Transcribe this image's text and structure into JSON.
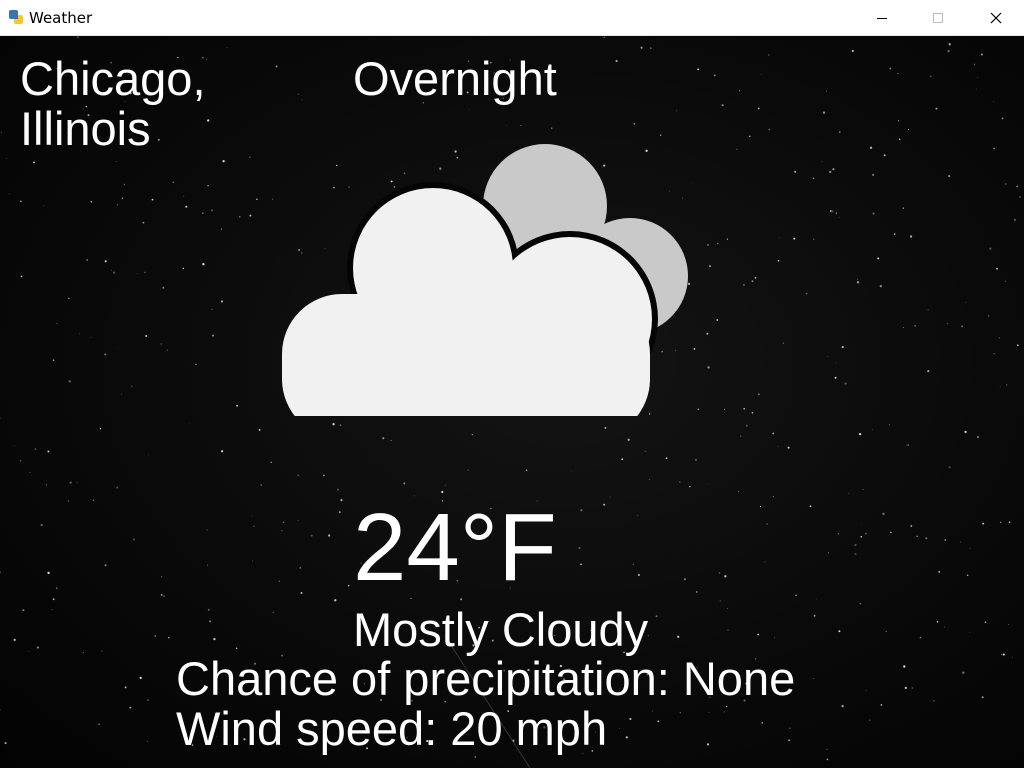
{
  "window": {
    "title": "Weather",
    "icon": "python-app-icon",
    "controls": [
      "minimize",
      "maximize",
      "close"
    ]
  },
  "weather": {
    "city": "Chicago, Illinois",
    "period": "Overnight",
    "temperature": "24°F",
    "condition": "Mostly Cloudy",
    "icon": "mostly-cloudy-icon",
    "precipitation": "Chance of precipitation: None",
    "wind": "Wind speed: 20 mph"
  },
  "colors": {
    "background": "#000000",
    "text": "#ffffff",
    "cloud_front": "#f1f1f1",
    "cloud_back": "#c9c9c9"
  }
}
